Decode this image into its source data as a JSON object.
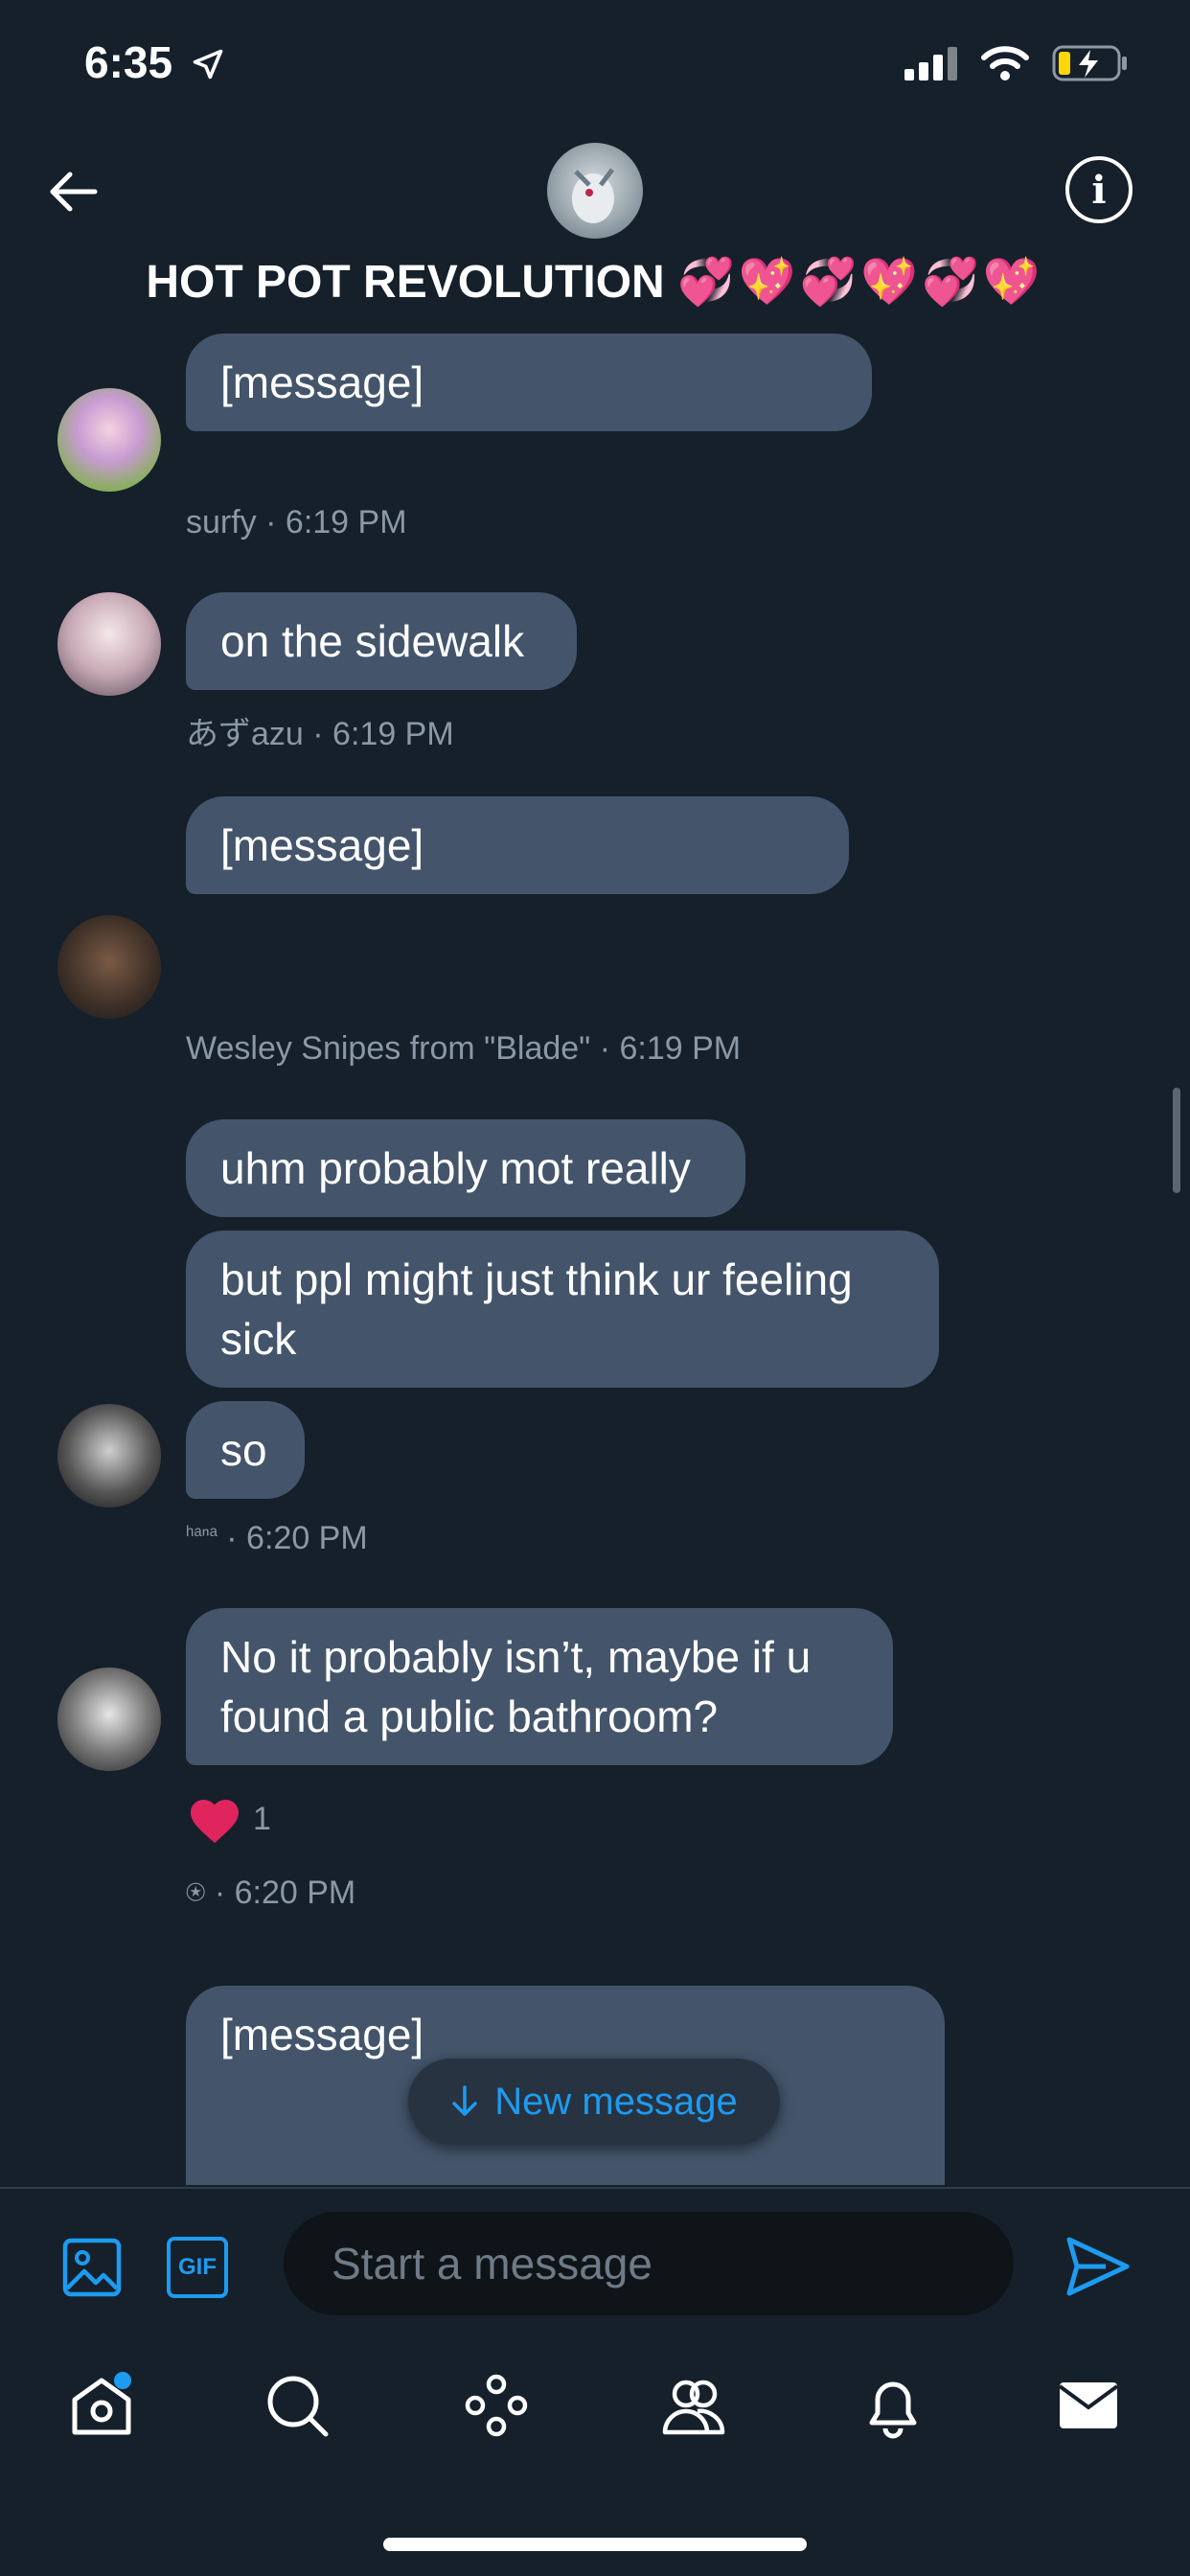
{
  "status": {
    "time": "6:35"
  },
  "header": {
    "title": "HOT POT REVOLUTION",
    "title_emoji": "💞💖💞💖💞💖"
  },
  "messages": [
    {
      "sender": "surfy",
      "time": "· 6:19 PM",
      "bubbles": [
        "[message]"
      ]
    },
    {
      "sender": "あずazu",
      "time": "· 6:19 PM",
      "bubbles": [
        "on the sidewalk"
      ]
    },
    {
      "sender": "Wesley Snipes from \"Blade\"",
      "time": "· 6:19 PM",
      "bubbles": [
        "[message]"
      ]
    },
    {
      "sender": "ʰᵃⁿᵃ",
      "time": "· 6:20 PM",
      "bubbles": [
        "uhm probably mot really",
        "but ppl might just think ur feeling sick",
        "so"
      ]
    },
    {
      "sender": "⍟",
      "time": "· 6:20 PM",
      "bubbles": [
        "No it probably isn’t, maybe if u found a public bathroom?"
      ],
      "reaction_count": "1"
    },
    {
      "bubbles": [
        "[message]"
      ]
    }
  ],
  "new_message_pill": "New message",
  "composer": {
    "placeholder": "Start a message",
    "gif_label": "GIF"
  },
  "colors": {
    "background": "#15202b",
    "bubble": "#44556b",
    "accent": "#1d9bf0",
    "heart": "#e0245e"
  },
  "icons": [
    "back-arrow-icon",
    "info-icon",
    "image-icon",
    "gif-icon",
    "send-icon",
    "home-icon",
    "search-icon",
    "spaces-icon",
    "communities-icon",
    "bell-icon",
    "mail-icon"
  ]
}
